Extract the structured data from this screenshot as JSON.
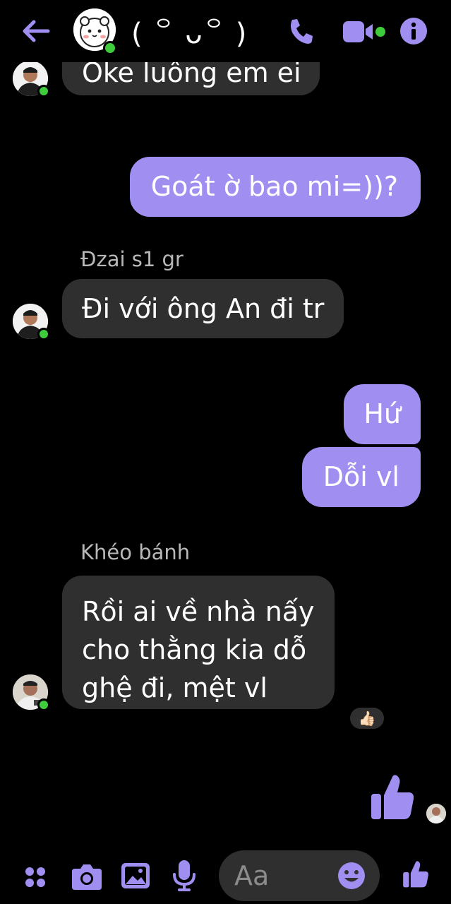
{
  "colors": {
    "accent": "#a08ff0",
    "incoming_bubble": "#2f2f2f",
    "online": "#3ecc3c",
    "background": "#000000"
  },
  "header": {
    "title": "( ꒪ ᴗ꒪ )",
    "icons": [
      "back-arrow-icon",
      "phone-icon",
      "video-camera-icon",
      "info-icon"
    ]
  },
  "messages": [
    {
      "direction": "incoming",
      "text": "Oke luông em ei"
    },
    {
      "direction": "outgoing",
      "text": "Goát ờ bao mi=))?"
    },
    {
      "direction": "incoming",
      "sender": "Đzai s1 gr",
      "text": "Đi với ông An đi tr"
    },
    {
      "direction": "outgoing",
      "text": "Hứ"
    },
    {
      "direction": "outgoing",
      "text": "Dỗi vl"
    },
    {
      "direction": "incoming",
      "sender": "Khéo bánh",
      "lines": [
        "Rồi ai về nhà nấy",
        "cho thằng kia dỗ",
        "ghệ đi, mệt vl"
      ],
      "reaction": "👍🏻"
    },
    {
      "direction": "outgoing",
      "sticker": "thumbs-up-icon"
    }
  ],
  "composer": {
    "placeholder": "Aa"
  },
  "toolbar": {
    "icons": [
      "menu-dots-icon",
      "camera-icon",
      "gallery-icon",
      "microphone-icon",
      "emoji-icon",
      "thumbs-up-icon"
    ]
  }
}
